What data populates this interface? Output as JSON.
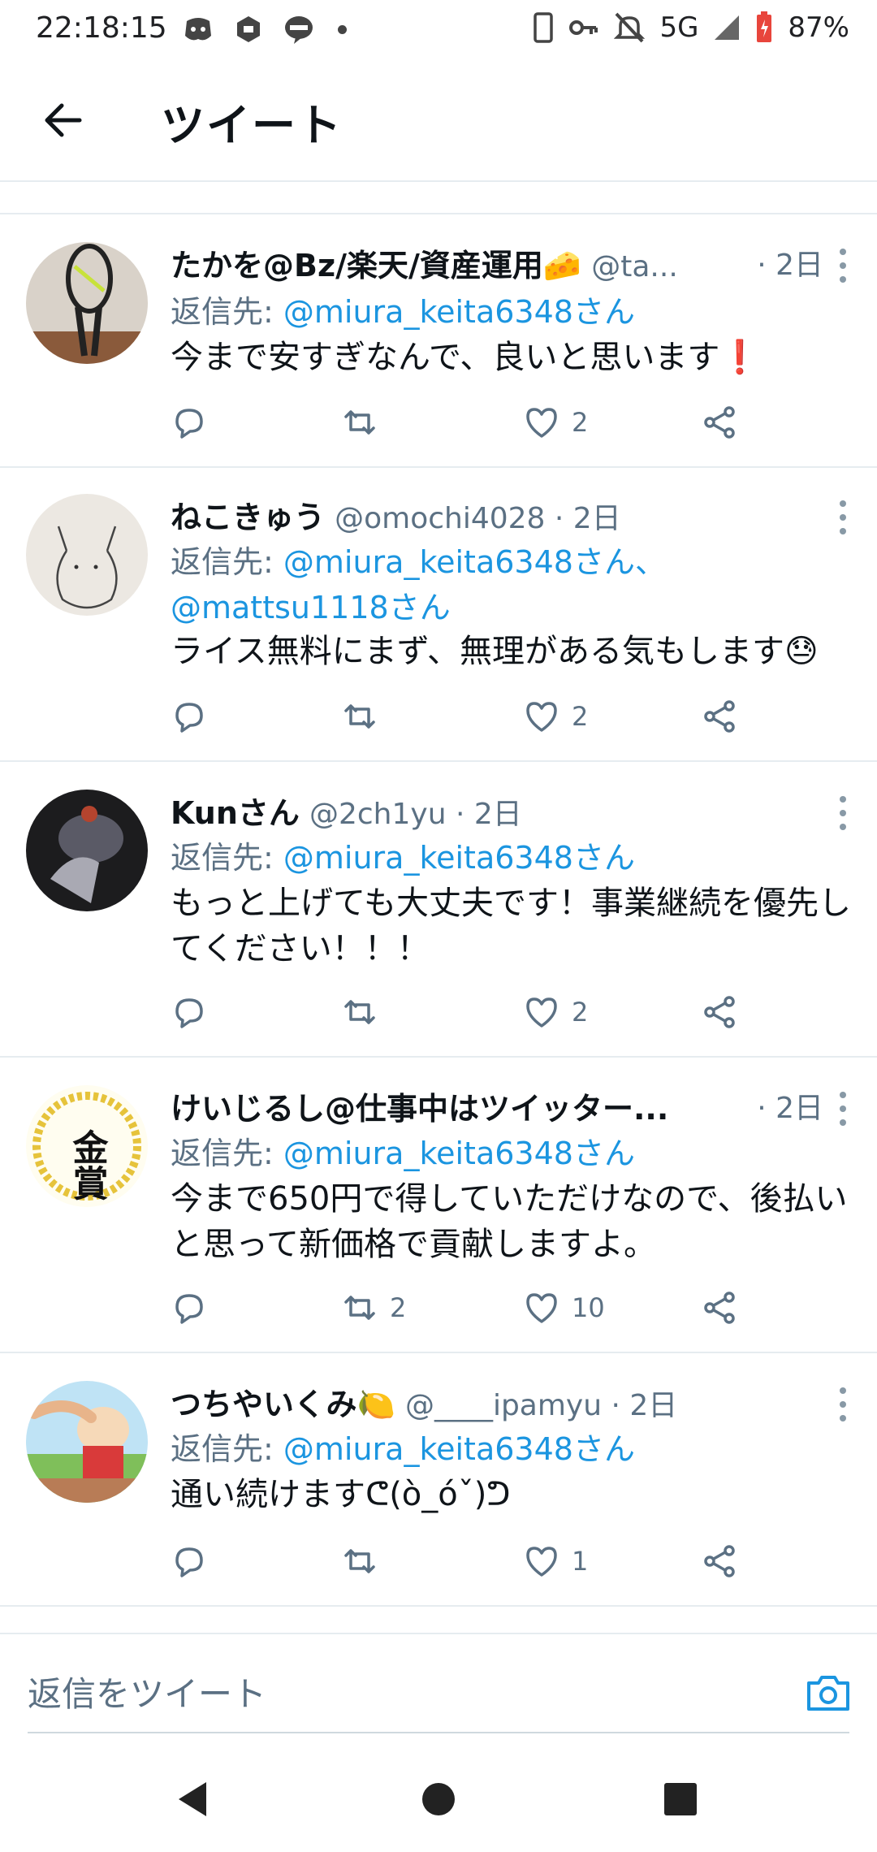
{
  "status_bar": {
    "time": "22:18:15",
    "network": "5G",
    "battery": "87%",
    "icons_left": [
      "discord-icon",
      "mi-icon",
      "line-icon",
      "dot-icon"
    ],
    "icons_right": [
      "phone-icon",
      "key-icon",
      "mute-icon",
      "signal-icon",
      "battery-icon"
    ]
  },
  "header": {
    "title": "ツイート",
    "back_icon": "arrow-left-icon"
  },
  "tweets": [
    {
      "name": "たかを@Bz/楽天/資産運用🧀",
      "handle": "@ta...",
      "time": "· 2日",
      "reply_label": "返信先: ",
      "reply_to": "@miura_keita6348さん",
      "text": "今まで安すぎなんで、良いと思います❗",
      "retweets": "",
      "likes": "2"
    },
    {
      "name": "ねこきゅう",
      "handle": "@omochi4028 · 2日",
      "time": "",
      "reply_label": "返信先: ",
      "reply_to": "@miura_keita6348さん、",
      "reply_to_2": "@mattsu1118さん",
      "text": "ライス無料にまず、無理がある気もします😓",
      "retweets": "",
      "likes": "2"
    },
    {
      "name": "Kunさん",
      "handle": "@2ch1yu · 2日",
      "time": "",
      "reply_label": "返信先: ",
      "reply_to": "@miura_keita6348さん",
      "text": "もっと上げても大丈夫です！事業継続を優先してください！！！",
      "retweets": "",
      "likes": "2"
    },
    {
      "name": "けいじるし@仕事中はツイッター...",
      "handle": "",
      "time": "· 2日",
      "avatar_text": "金賞",
      "reply_label": "返信先: ",
      "reply_to": "@miura_keita6348さん",
      "text": "今まで650円で得していただけなので、後払いと思って新価格で貢献しますよ。",
      "retweets": "2",
      "likes": "10"
    },
    {
      "name": "つちやいくみ🍋",
      "handle": "@____ipamyu · 2日",
      "time": "",
      "reply_label": "返信先: ",
      "reply_to": "@miura_keita6348さん",
      "text": "通い続けますᕦ(ò_óˇ)ᕤ",
      "retweets": "",
      "likes": "1"
    }
  ],
  "reply_bar": {
    "placeholder": "返信をツイート",
    "camera_icon": "camera-icon"
  },
  "colors": {
    "accent": "#1b95e0",
    "secondary_text": "#5b7083",
    "divider": "#e6ecf0"
  }
}
